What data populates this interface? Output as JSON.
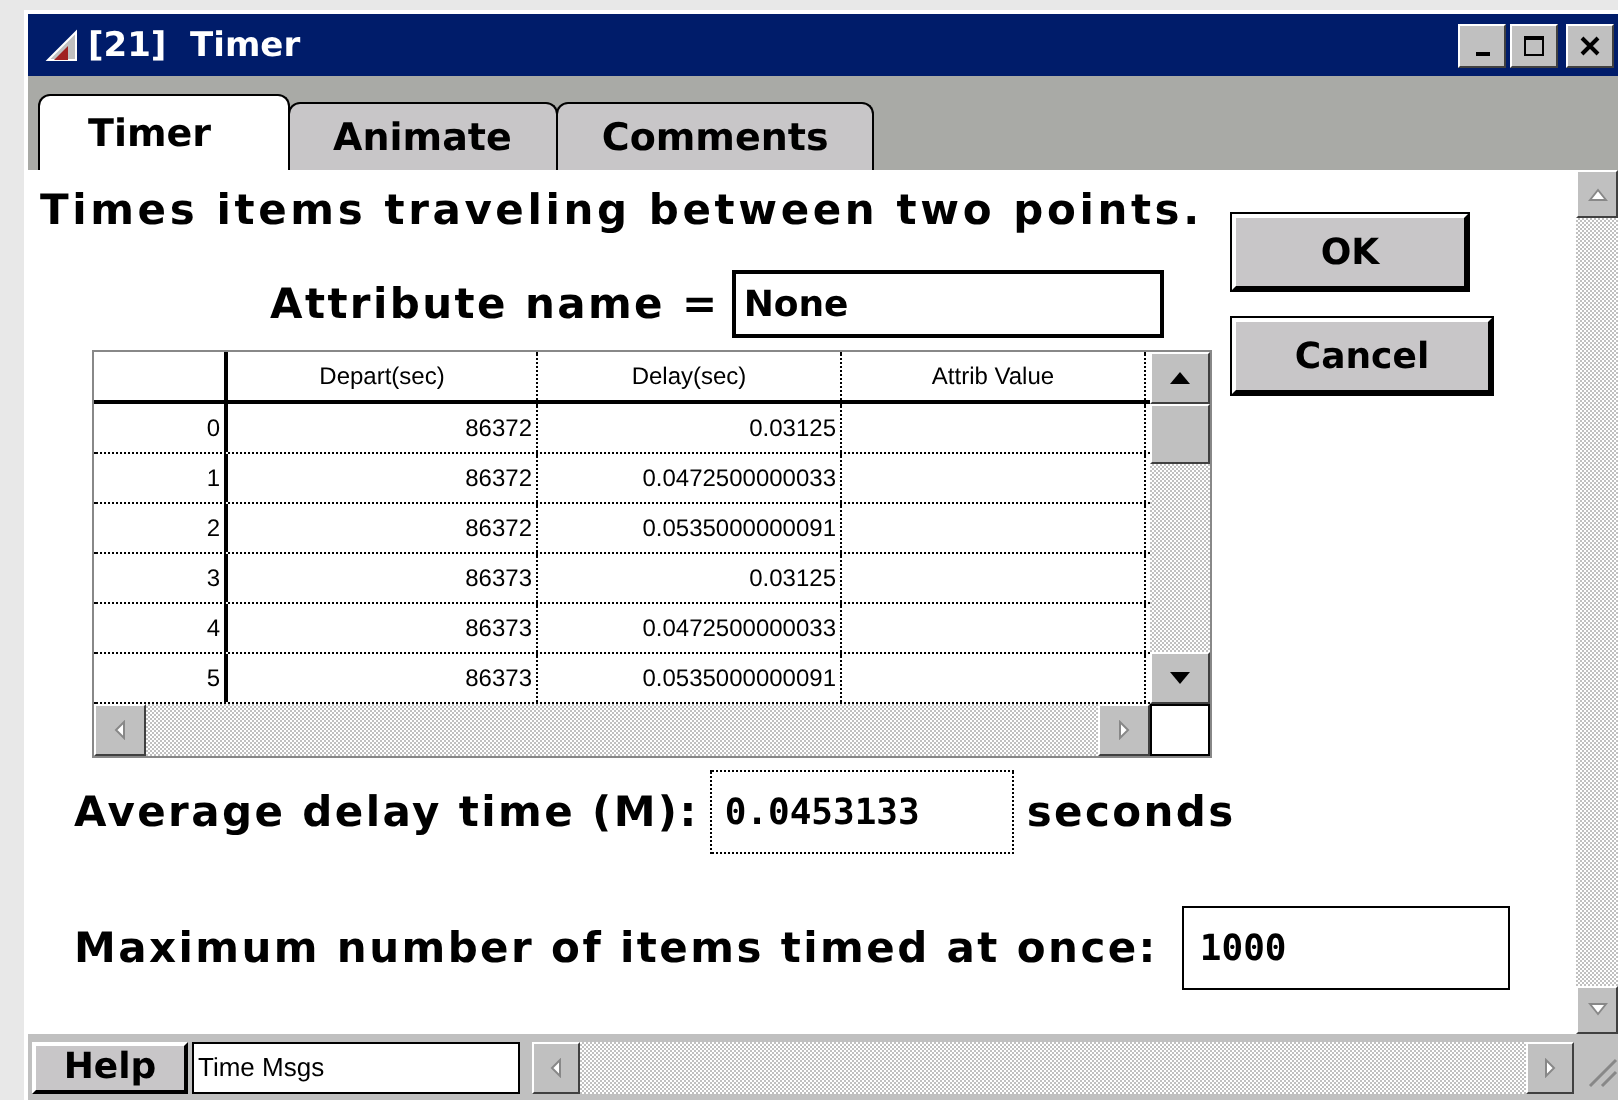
{
  "window": {
    "title": "[21]  Timer"
  },
  "tabs": [
    {
      "label": "Timer",
      "selected": true
    },
    {
      "label": "Animate",
      "selected": false
    },
    {
      "label": "Comments",
      "selected": false
    }
  ],
  "description": "Times items traveling between two points.",
  "attribute": {
    "label": "Attribute name =",
    "value": "None"
  },
  "buttons": [
    "OK",
    "Cancel"
  ],
  "table": {
    "columns": [
      "Depart(sec)",
      "Delay(sec)",
      "Attrib Value"
    ],
    "rows": [
      {
        "index": "0",
        "depart": "86372",
        "delay": "0.03125"
      },
      {
        "index": "1",
        "depart": "86372",
        "delay": "0.0472500000033"
      },
      {
        "index": "2",
        "depart": "86372",
        "delay": "0.0535000000091"
      },
      {
        "index": "3",
        "depart": "86373",
        "delay": "0.03125"
      },
      {
        "index": "4",
        "depart": "86373",
        "delay": "0.0472500000033"
      },
      {
        "index": "5",
        "depart": "86373",
        "delay": "0.0535000000091"
      }
    ]
  },
  "average": {
    "label": "Average delay time (M):",
    "value": "0.0453133",
    "unit": "seconds"
  },
  "maximum": {
    "label": "Maximum number of items timed at once:",
    "value": "1000"
  },
  "footer": {
    "help": "Help",
    "field": "Time Msgs"
  }
}
